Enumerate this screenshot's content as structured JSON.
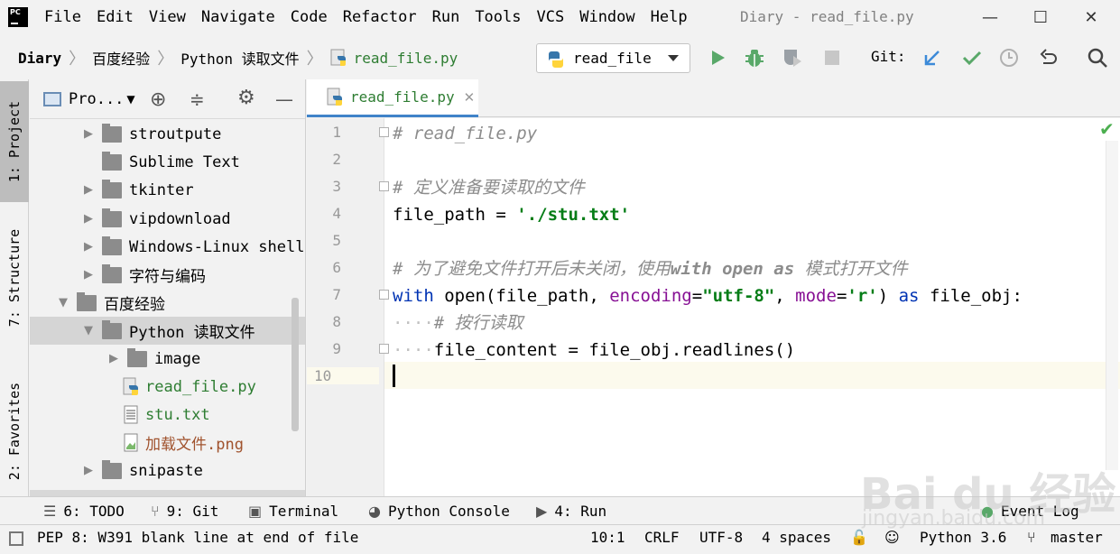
{
  "menubar": {
    "items": [
      "File",
      "Edit",
      "View",
      "Navigate",
      "Code",
      "Refactor",
      "Run",
      "Tools",
      "VCS",
      "Window",
      "Help"
    ],
    "title": "Diary - read_file.py"
  },
  "window_controls": {
    "minimize": "—",
    "maximize": "☐",
    "close": "✕"
  },
  "navbar": {
    "breadcrumbs": [
      "Diary",
      "百度经验",
      "Python 读取文件",
      "read_file.py"
    ],
    "run_config": "read_file",
    "git_label": "Git:"
  },
  "left_strip": {
    "project": "1: Project",
    "structure": "7: Structure",
    "favorites": "2: Favorites"
  },
  "project_panel": {
    "title": "Pro...",
    "items": [
      {
        "label": "stroutpute",
        "type": "folder",
        "expandable": true,
        "level": 1
      },
      {
        "label": "Sublime Text",
        "type": "folder",
        "expandable": false,
        "level": 1
      },
      {
        "label": "tkinter",
        "type": "folder",
        "expandable": true,
        "level": 1
      },
      {
        "label": "vipdownload",
        "type": "folder",
        "expandable": true,
        "level": 1
      },
      {
        "label": "Windows-Linux shell",
        "type": "folder",
        "expandable": true,
        "level": 1
      },
      {
        "label": "字符与编码",
        "type": "folder",
        "expandable": true,
        "level": 1
      },
      {
        "label": "百度经验",
        "type": "folder",
        "expandable": true,
        "expanded": true,
        "level": 0
      },
      {
        "label": "Python 读取文件",
        "type": "folder",
        "expandable": true,
        "expanded": true,
        "selected": true,
        "level": 1
      },
      {
        "label": "image",
        "type": "folder",
        "expandable": true,
        "level": 2
      },
      {
        "label": "read_file.py",
        "type": "python",
        "level": 2
      },
      {
        "label": "stu.txt",
        "type": "text",
        "level": 2
      },
      {
        "label": "加载文件.png",
        "type": "image",
        "level": 2
      },
      {
        "label": "snipaste",
        "type": "folder",
        "expandable": true,
        "level": 1
      }
    ]
  },
  "editor": {
    "tab": "read_file.py",
    "line_numbers": [
      "1",
      "2",
      "3",
      "4",
      "5",
      "6",
      "7",
      "8",
      "9",
      "10"
    ],
    "code": {
      "l1": "# read_file.py",
      "l3": "# 定义准备要读取的文件",
      "l4_var": "file_path",
      "l4_eq": " = ",
      "l4_str": "'./stu.txt'",
      "l6_a": "# 为了避免文件打开后未关闭，使用",
      "l6_b": "with open as",
      "l6_c": " 模式打开文件",
      "l7_with": "with",
      "l7_open": " open(file_path, ",
      "l7_enc": "encoding",
      "l7_eq1": "=",
      "l7_encv": "\"utf-8\"",
      "l7_comma": ", ",
      "l7_mode": "mode",
      "l7_eq2": "=",
      "l7_modev": "'r'",
      "l7_close": ") ",
      "l7_as": "as",
      "l7_obj": " file_obj:",
      "l8_ws": "····",
      "l8_cmt": "# 按行读取",
      "l9_ws": "····",
      "l9_code": "file_content = file_obj.readlines()"
    }
  },
  "toolwindows": [
    {
      "icon": "☰",
      "label": "6: TODO"
    },
    {
      "icon": "⑂",
      "label": "9: Git"
    },
    {
      "icon": "▣",
      "label": "Terminal"
    },
    {
      "icon": "◕",
      "label": "Python Console"
    },
    {
      "icon": "▶",
      "label": "4: Run"
    },
    {
      "icon": "●",
      "label": "Event Log"
    }
  ],
  "statusbar": {
    "message": "PEP 8: W391 blank line at end of file",
    "position": "10:1",
    "line_sep": "CRLF",
    "encoding": "UTF-8",
    "indent": "4 spaces",
    "interpreter": "Python 3.6",
    "branch": "master"
  },
  "watermark": {
    "text": "Bai du 经验",
    "sub": "jingyan.baidu.com"
  },
  "colors": {
    "accent": "#4083c9",
    "run_green": "#59a869",
    "string_green": "#067d17",
    "keyword_blue": "#0033b3",
    "kwarg_purple": "#871094",
    "comment_gray": "#8c8c8c"
  }
}
